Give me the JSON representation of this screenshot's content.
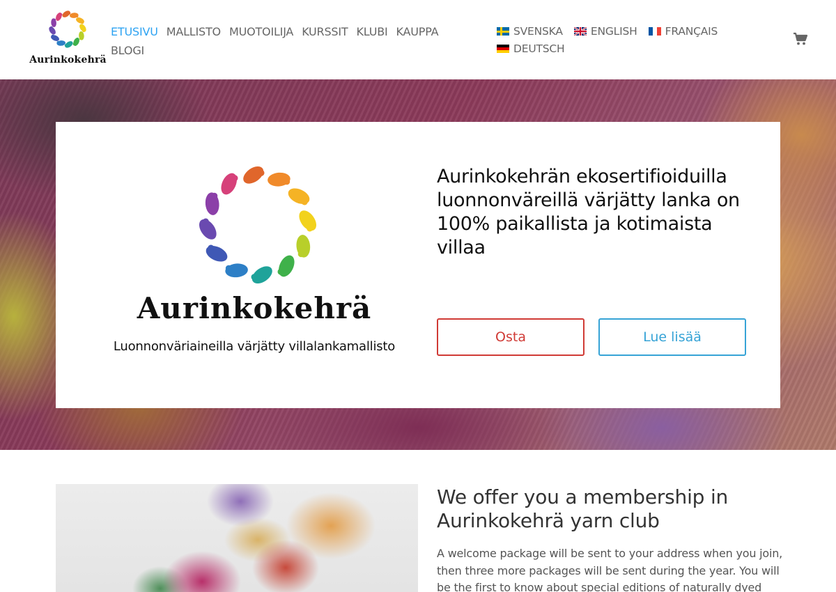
{
  "header": {
    "logo_text": "Aurinkokehrä",
    "nav": {
      "items": [
        {
          "label": "ETUSIVU",
          "active": true
        },
        {
          "label": "MALLISTO",
          "active": false
        },
        {
          "label": "MUOTOILIJA",
          "active": false
        },
        {
          "label": "KURSSIT",
          "active": false
        },
        {
          "label": "KLUBI",
          "active": false
        },
        {
          "label": "KAUPPA",
          "active": false
        },
        {
          "label": "BLOGI",
          "active": false
        }
      ]
    },
    "languages": [
      {
        "label": "SVENSKA",
        "flag": "sweden-flag"
      },
      {
        "label": "ENGLISH",
        "flag": "uk-flag"
      },
      {
        "label": "FRANÇAIS",
        "flag": "france-flag"
      },
      {
        "label": "DEUTSCH",
        "flag": "germany-flag"
      }
    ],
    "cart_icon": "cart-icon"
  },
  "hero": {
    "logo_text": "Aurinkokehrä",
    "tagline": "Luonnonväriaineilla värjätty villalankamallisto",
    "heading": "Aurinkokehrän ekosertifioiduilla luonnonväreillä värjätty lanka on 100% paikallista ja kotimaista villaa",
    "buy_button": "Osta",
    "more_button": "Lue lisää"
  },
  "club": {
    "heading": "We offer you a membership in Aurinkokehrä yarn club",
    "text": "A welcome package will be sent to your address when you join, then three more packages will be sent during the year. You will be the first to know about special editions of naturally dyed"
  },
  "colors": {
    "nav_active": "#2ea3f2",
    "buy_button": "#d03a35",
    "more_button": "#36a3d6",
    "logo_swirl": [
      "#d6417a",
      "#e0662b",
      "#f08a2a",
      "#f5b325",
      "#f2d21c",
      "#b8cf2a",
      "#3fb14a",
      "#1fa39a",
      "#2d7fc6",
      "#3f58b5",
      "#6a4ab0",
      "#8b3fa8"
    ]
  }
}
